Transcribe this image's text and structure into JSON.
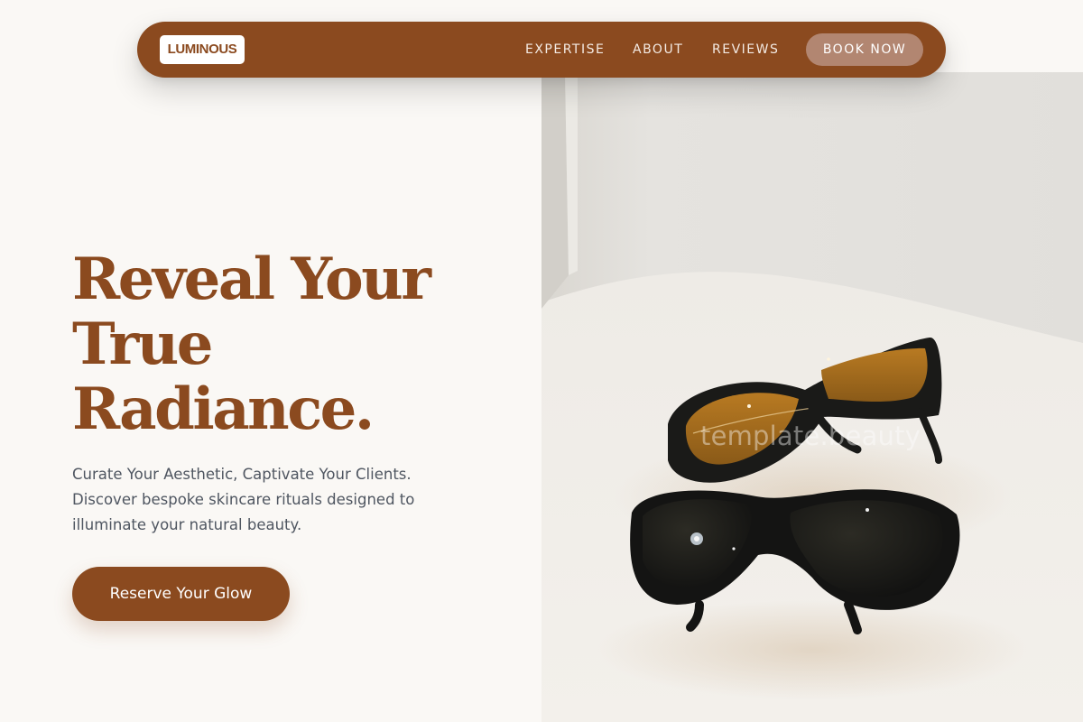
{
  "brand": {
    "logo_text": "LUMINOUS"
  },
  "nav": {
    "items": [
      {
        "label": "EXPERTISE"
      },
      {
        "label": "ABOUT"
      },
      {
        "label": "REVIEWS"
      }
    ],
    "cta_label": "BOOK NOW"
  },
  "hero": {
    "title_lines": [
      "Reveal Your",
      "True",
      "Radiance."
    ],
    "subtitle_lines": [
      "Curate Your Aesthetic, Captivate Your Clients.",
      "Discover bespoke skincare rituals designed to",
      "illuminate your natural beauty."
    ],
    "cta_label": "Reserve Your Glow",
    "image_watermark": "template.beauty"
  },
  "colors": {
    "brand_brown": "#8b4a1f",
    "nav_button": "#b28671",
    "page_background": "#faf8f5",
    "body_text": "#4f5661"
  },
  "icons": {
    "hero_image": "protective-eyewear-photo"
  }
}
